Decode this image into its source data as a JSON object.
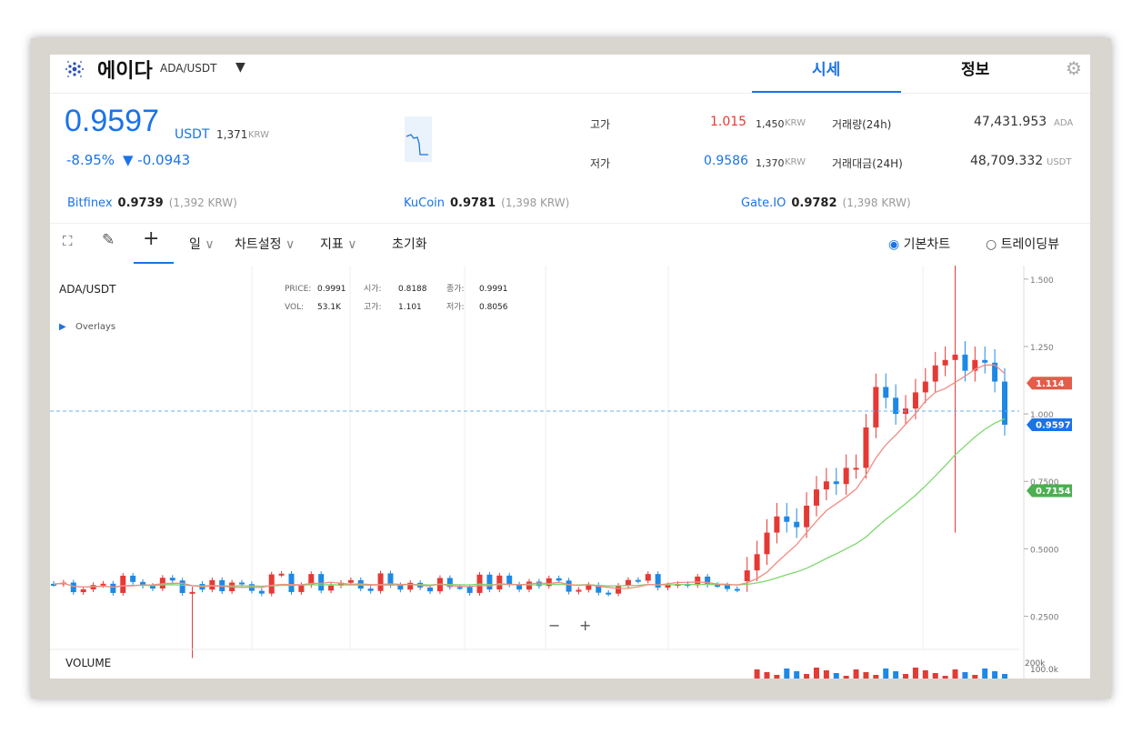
{
  "header": {
    "coin_name": "에이다",
    "pair": "ADA/USDT",
    "tabs": [
      "시세",
      "정보"
    ]
  },
  "price": {
    "value": "0.9597",
    "unit": "USDT",
    "krw_value": "1,371",
    "krw_unit": "KRW",
    "change_pct": "-8.95%",
    "change_abs": "▼ -0.0943"
  },
  "stats": {
    "high_label": "고가",
    "high_value": "1.015",
    "high_krw": "1,450",
    "low_label": "저가",
    "low_value": "0.9586",
    "low_krw": "1,370",
    "krw_unit": "KRW",
    "vol_label": "거래량(24h)",
    "vol_value": "47,431.953",
    "vol_unit": "ADA",
    "amt_label": "거래대금(24H)",
    "amt_value": "48,709.332",
    "amt_unit": "USDT"
  },
  "exchanges": [
    {
      "name": "Bitfinex",
      "price": "0.9739",
      "krw": "(1,392 KRW)"
    },
    {
      "name": "KuCoin",
      "price": "0.9781",
      "krw": "(1,398 KRW)"
    },
    {
      "name": "Gate.IO",
      "price": "0.9782",
      "krw": "(1,398 KRW)"
    }
  ],
  "toolbar": {
    "interval": "일",
    "chart_settings": "차트설정",
    "indicators": "지표",
    "reset": "초기화",
    "radio_basic": "기본차트",
    "radio_tv": "트레이딩뷰"
  },
  "chart_data": {
    "type": "candlestick",
    "symbol": "ADA/USDT",
    "overlays_label": "Overlays",
    "legend": {
      "price_label": "PRICE:",
      "price": "0.9991",
      "open_label": "시가:",
      "open": "0.8188",
      "close_label": "종가:",
      "close": "0.9991",
      "vol_label": "VOL:",
      "vol": "53.1K",
      "high_label": "고가:",
      "high": "1.101",
      "low_label": "저가:",
      "low": "0.8056"
    },
    "y_ticks": [
      "1.500",
      "1.250",
      "1.000",
      "0.7500",
      "0.5000",
      "0.2500"
    ],
    "ylim": [
      0.1,
      1.55
    ],
    "badges": [
      {
        "label": "1.114",
        "color": "#e35d4a"
      },
      {
        "label": "0.9597",
        "color": "#1a73e8"
      },
      {
        "label": "0.7154",
        "color": "#4caf50"
      }
    ],
    "zoom_minus": "−",
    "zoom_plus": "+",
    "volume_label": "VOLUME",
    "volume_tick": "200k",
    "volume_tick2": "100.0k",
    "colors": {
      "up": "#e53935",
      "down": "#1e88e5",
      "ma_fast": "#f28b82",
      "ma_slow": "#7ed66f"
    }
  }
}
